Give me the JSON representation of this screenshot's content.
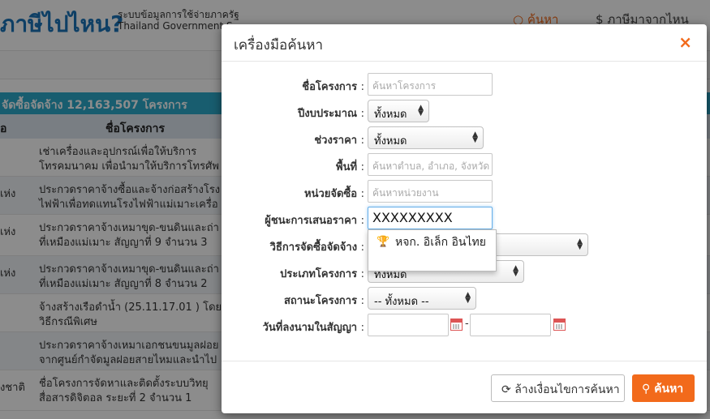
{
  "header": {
    "brand": "ภาษีไปไหน?",
    "subtitle_th": "ระบบข้อมูลการใช้จ่ายภาครัฐ",
    "subtitle_en": "Thailand Government S",
    "search_label": "ค้นหา",
    "right_label": "ภาษีมาจากไหน"
  },
  "background": {
    "banner": "จัดซื้อจัดจ้าง 12,163,507 โครงการ",
    "columns": [
      "อ",
      "ชื่อโครงการ"
    ],
    "rows": [
      {
        "c1": "",
        "lines": [
          "เช่าเครื่องและอุปกรณ์เพื่อให้บริการ",
          "โทรคมนาคม เพื่อนำมาให้บริการโทรศัพ"
        ]
      },
      {
        "c1": "เห่ง",
        "lines": [
          "ประกวดราคาจ้างซื้อและจ้างก่อสร้างโรง",
          "ไฟฟ้าเพื่อทดแทนโรงไฟฟ้าแม่เมาะเครื่อ"
        ]
      },
      {
        "c1": "เห่ง",
        "lines": [
          "ประกวดราคาจ้างเหมาขุด-ขนดินและถ่า",
          "ที่เหมืองแม่เมาะ สัญญาที่ 9 จำนวน 3"
        ]
      },
      {
        "c1": "เห่ง",
        "lines": [
          "ประกวดราคาจ้างเหมาขุด-ขนดินและถ่า",
          "ที่เหมืองแม่เมาะ สัญญาที่ 8 จำนวน 2"
        ]
      },
      {
        "c1": "",
        "lines": [
          "จ้างสร้างเรือดำน้ำ (25.11.17.01 ) โดย",
          "วิธีกรณีพิเศษ"
        ]
      },
      {
        "c1": "",
        "lines": [
          "ประกวดราคาจ้างเหมาเอกชนขนมูลฝอย",
          "จากศูนย์กำจัดมูลฝอยสายไหมและนำไป"
        ]
      },
      {
        "c1": "งชาติ",
        "lines": [
          "ชื่อโครงการจัดหาและติดตั้งระบบวิทยุ",
          "สื่อสารดิจิตอล ระยะที่ 2 จำนวน 1"
        ]
      }
    ]
  },
  "modal": {
    "title": "เครื่องมือค้นหา",
    "close": "×",
    "fields": {
      "project_name": {
        "label": "ชื่อโครงการ",
        "placeholder": "ค้นหาโครงการ"
      },
      "fiscal_year": {
        "label": "ปีงบประมาณ",
        "value": "ทั้งหมด"
      },
      "price_range": {
        "label": "ช่วงราคา",
        "value": "ทั้งหมด"
      },
      "area": {
        "label": "พื้นที่",
        "placeholder": "ค้นหาตำบล, อำเภอ, จังหวัด"
      },
      "agency": {
        "label": "หน่วยจัดซื้อ",
        "placeholder": "ค้นหาหน่วยงาน"
      },
      "winner": {
        "label": "ผู้ชนะการเสนอราคา",
        "value": "XXXXXXXXX"
      },
      "procurement_method": {
        "label": "วิธีการจัดซื้อจัดจ้าง",
        "value": ""
      },
      "project_type": {
        "label": "ประเภทโครงการ",
        "value": "ทั้งหมด"
      },
      "project_status": {
        "label": "สถานะโครงการ",
        "value": "-- ทั้งหมด --"
      },
      "contract_date": {
        "label": "วันที่ลงนามในสัญญา",
        "from": "",
        "to": "",
        "separator": "-"
      }
    },
    "colon": ":",
    "autocomplete": {
      "icon": "trophy-icon",
      "text": "หจก. อิเล็ก อินไทย"
    },
    "buttons": {
      "clear": "ล้างเงื่อนไขการค้นหา",
      "search": "ค้นหา"
    },
    "colors": {
      "accent": "#f26a1b",
      "banner": "#2caacb"
    }
  }
}
